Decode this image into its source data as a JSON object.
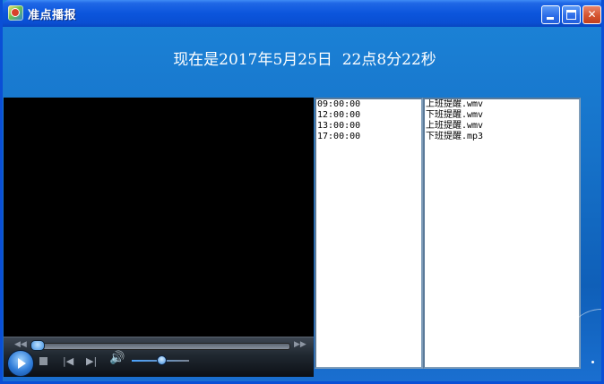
{
  "window": {
    "title": "准点播报",
    "controls": {
      "minimize_icon": "minimize-icon",
      "maximize_icon": "maximize-icon",
      "close_icon": "close-icon"
    }
  },
  "clock": {
    "text": "现在是2017年5月25日  22点8分22秒"
  },
  "player": {
    "seek_progress": 0,
    "volume_level": 0.5,
    "icons": [
      "rewind-icon",
      "fast-forward-icon",
      "play-icon",
      "stop-icon",
      "previous-icon",
      "next-icon",
      "volume-icon"
    ]
  },
  "schedule": {
    "times": [
      "09:00:00",
      "12:00:00",
      "13:00:00",
      "17:00:00"
    ],
    "files": [
      "上班提醒.wmv",
      "下班提醒.wmv",
      "上班提醒.wmv",
      "下班提醒.mp3"
    ]
  },
  "colors": {
    "titlebar": "#0b55dc",
    "background": "#1672c9",
    "player_bg": "#000000"
  }
}
